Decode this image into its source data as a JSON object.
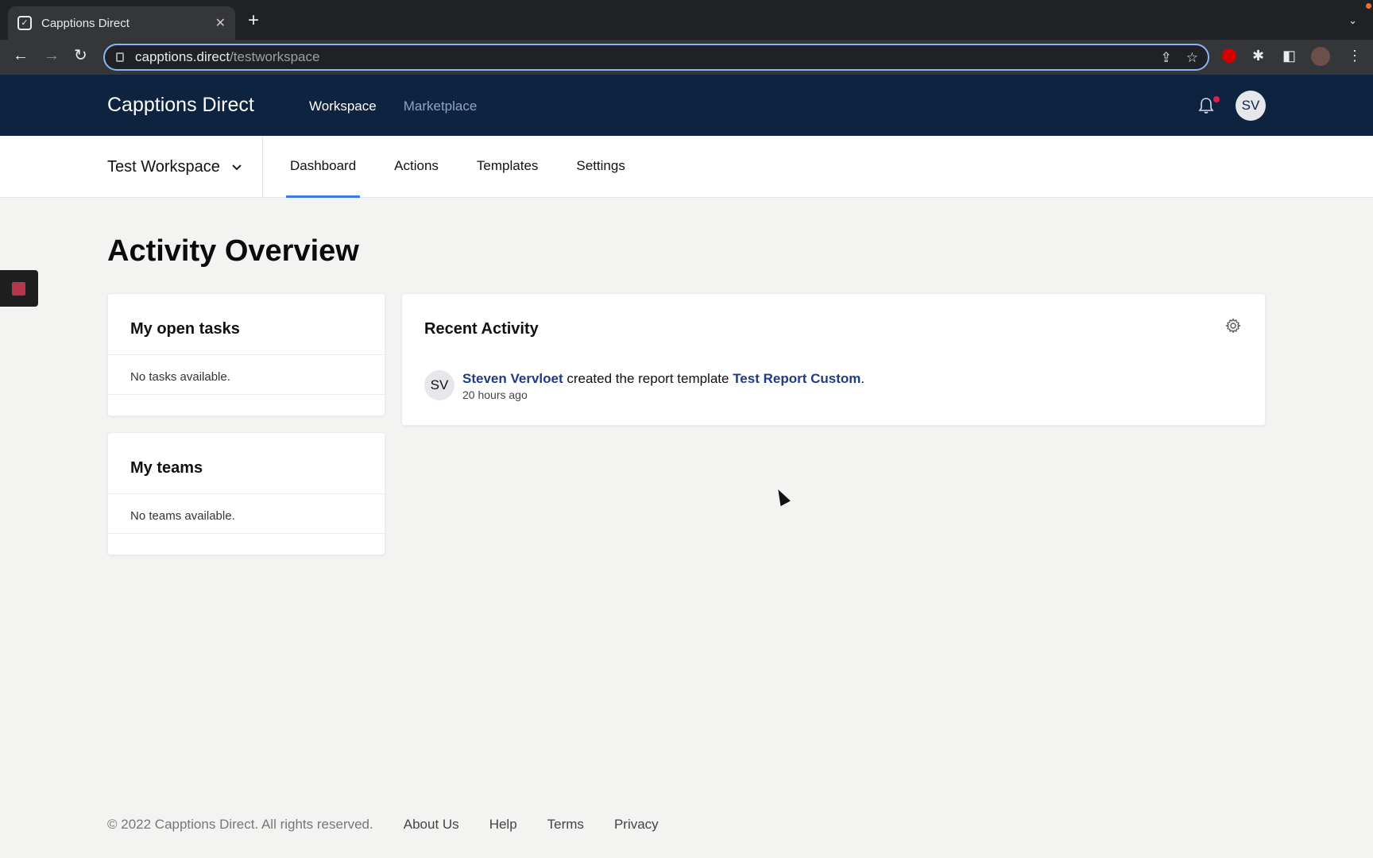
{
  "browser": {
    "tab_title": "Capptions Direct",
    "tab_close": "✕",
    "new_tab": "+",
    "url_host": "capptions.direct",
    "url_path": "/testworkspace"
  },
  "header": {
    "brand": "Capptions Direct",
    "nav": [
      {
        "label": "Workspace",
        "active": true
      },
      {
        "label": "Marketplace",
        "active": false
      }
    ],
    "avatar_initials": "SV"
  },
  "subheader": {
    "workspace_name": "Test Workspace",
    "tabs": [
      {
        "label": "Dashboard",
        "active": true
      },
      {
        "label": "Actions",
        "active": false
      },
      {
        "label": "Templates",
        "active": false
      },
      {
        "label": "Settings",
        "active": false
      }
    ]
  },
  "main": {
    "title": "Activity Overview",
    "open_tasks": {
      "title": "My open tasks",
      "empty": "No tasks available."
    },
    "teams": {
      "title": "My teams",
      "empty": "No teams available."
    },
    "recent_activity": {
      "title": "Recent Activity",
      "items": [
        {
          "initials": "SV",
          "actor": "Steven Vervloet",
          "action": " created the report template ",
          "object": "Test Report Custom",
          "suffix": ".",
          "time": "20 hours ago"
        }
      ]
    }
  },
  "footer": {
    "copyright": "© 2022 Capptions Direct. All rights reserved.",
    "links": [
      "About Us",
      "Help",
      "Terms",
      "Privacy"
    ]
  },
  "colors": {
    "header_bg": "#0e2340",
    "accent": "#3b7ddd",
    "link": "#1e3a8a",
    "notification": "#e11d48"
  }
}
